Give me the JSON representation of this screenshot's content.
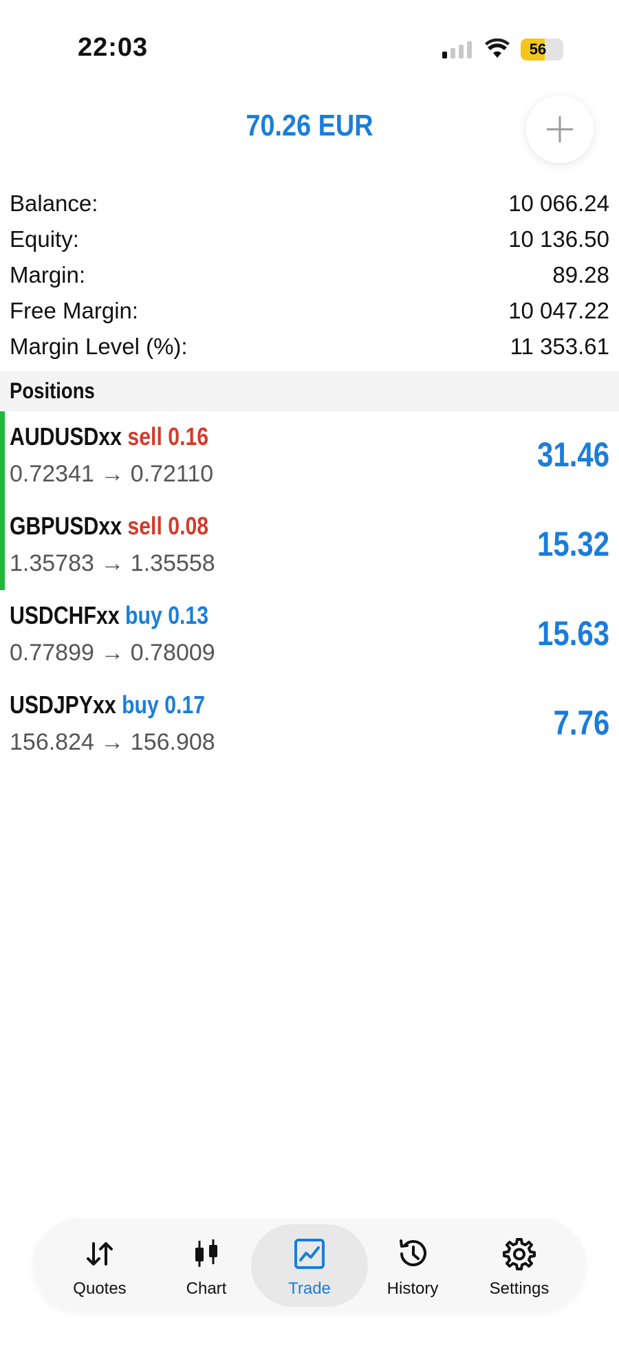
{
  "status_bar": {
    "time": "22:03",
    "battery_level": "56",
    "battery_fraction": 0.56
  },
  "header": {
    "total": "70.26 EUR",
    "add_icon": "plus-icon"
  },
  "summary": [
    {
      "label": "Balance:",
      "value": "10 066.24"
    },
    {
      "label": "Equity:",
      "value": "10 136.50"
    },
    {
      "label": "Margin:",
      "value": "89.28"
    },
    {
      "label": "Free Margin:",
      "value": "10 047.22"
    },
    {
      "label": "Margin Level (%):",
      "value": "11 353.61"
    }
  ],
  "positions_title": "Positions",
  "positions": [
    {
      "symbol": "AUDUSDxx",
      "side": "sell 0.16",
      "prices": "0.72341 → 0.72110",
      "profit": "31.46",
      "marked": true
    },
    {
      "symbol": "GBPUSDxx",
      "side": "sell 0.08",
      "prices": "1.35783 → 1.35558",
      "profit": "15.32",
      "marked": true
    },
    {
      "symbol": "USDCHFxx",
      "side": "buy 0.13",
      "prices": "0.77899 → 0.78009",
      "profit": "15.63",
      "marked": false
    },
    {
      "symbol": "USDJPYxx",
      "side": "buy 0.17",
      "prices": "156.824 → 156.908",
      "profit": "7.76",
      "marked": false
    }
  ],
  "colors": {
    "accent": "#1a7ddb",
    "sell": "#d63a2a",
    "marker": "#22b83a"
  },
  "tabs": [
    {
      "label": "Quotes",
      "icon": "quotes-arrows-icon",
      "active": false
    },
    {
      "label": "Chart",
      "icon": "candlestick-chart-icon",
      "active": false
    },
    {
      "label": "Trade",
      "icon": "trade-chart-icon",
      "active": true
    },
    {
      "label": "History",
      "icon": "history-clock-icon",
      "active": false
    },
    {
      "label": "Settings",
      "icon": "gear-icon",
      "active": false
    }
  ]
}
